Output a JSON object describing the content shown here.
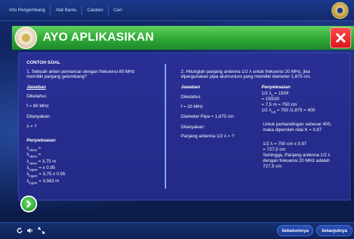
{
  "nav": {
    "items": [
      "Info Pengembang",
      "Alat Bantu",
      "Catatan",
      "Cari"
    ]
  },
  "banner": {
    "title": "AYO APLIKASIKAN"
  },
  "left": {
    "heading": "CONTOH SOAL",
    "question_line1": "1. Sebuah anten pemancar dengan frekuensi 80 MHz",
    "question_line2": "memiliki panjang gelombang?",
    "answer_heading": "Jawaban",
    "known_label": "Diketahui:",
    "known_value": "f = 80 MHz",
    "asked_label": "Ditanyakan:",
    "asked_value": "λ = ?",
    "solution_heading": "Penyelesaian",
    "steps": [
      {
        "sym": "λ",
        "sub": "udara",
        "rest": " ="
      },
      {
        "sym": "λ",
        "sub": "udara",
        "rest": " ="
      },
      {
        "sym": "λ",
        "sub": "udara",
        "rest": " = 3,75 m"
      },
      {
        "sym": "λ",
        "sub": "logam",
        "rest": " = x 0.95"
      },
      {
        "sym": "λ",
        "sub": "logam",
        "rest": " = 3,75 x 0.95"
      },
      {
        "sym": "λ",
        "sub": "logam",
        "rest": " = 3,562 m"
      }
    ]
  },
  "right": {
    "question_line1": "2. Hitunglah panjang antenna 1/2 λ untuk frekuensi 20 MHz, jika",
    "question_line2": "dipergunakan pipa alumunium yang memiliki diameter 1,875 cm.",
    "answer_heading": "Jawaban",
    "known_label": "Diketahui:",
    "known_f": "f = 20 MHz",
    "known_pipe": "Diameter Pipa = 1,875 cm",
    "asked_label": "Ditanyakan:",
    "asked_value": "Panjang antenna 1/2 λ = ?",
    "solution_heading": "Penyelesaian",
    "sol_line1": "1/2 λ",
    "sol_line1_sub": "u",
    "sol_line1_rest": " = 150/f",
    "sol_line2": "= 150/20",
    "sol_line3": "= 7,5 m = 750 cm",
    "sol_line4": "1/2 λ",
    "sol_line4_sub": "c/d",
    "sol_line4_rest": " = 750 /1,875 = 400",
    "comparison_line1": "Untuk perbandingan sebesar 400,",
    "comparison_line2": "maka diperoleh nilai K = 0,97",
    "calc_line1": "1/2 λ = 750 cm x 0.97",
    "calc_line2": "= 727,5 cm",
    "conclusion_line1": "Sehingga, Panjang antenna 1/2 λ",
    "conclusion_line2": "dengan frekuensi 20 MHz adalah",
    "conclusion_line3": "727,5 cm"
  },
  "footer": {
    "prev_label": "Sebelumnya",
    "next_label": "Selanjutnya"
  },
  "colors": {
    "banner_green": "#2ea736",
    "close_red": "#d8151d",
    "panel_blue": "#2a2f95",
    "divider": "#7fb2ff"
  },
  "icons": [
    "refresh-icon",
    "sound-icon",
    "fullscreen-icon",
    "next-arrow-icon",
    "close-icon"
  ]
}
